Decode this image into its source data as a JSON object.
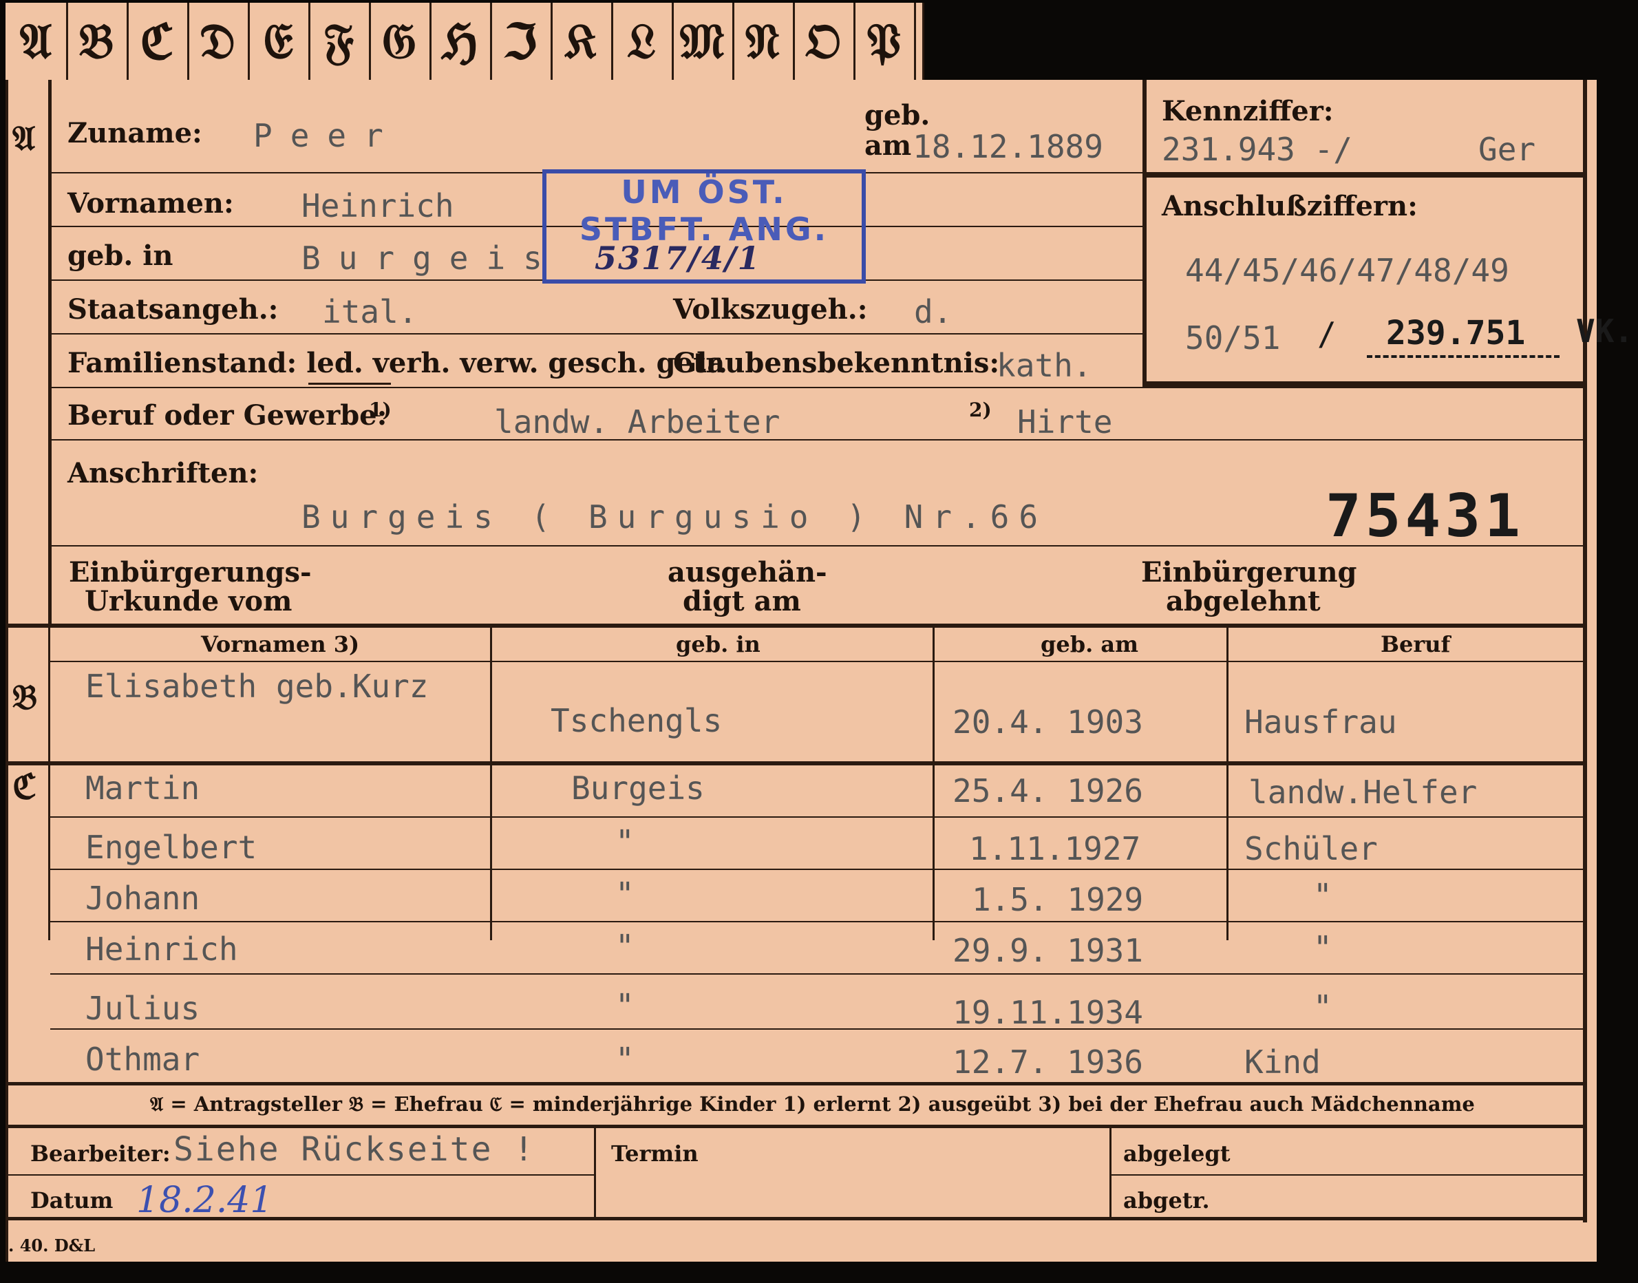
{
  "tabs": [
    "𝔄",
    "𝔅",
    "ℭ",
    "𝔇",
    "𝔈",
    "𝔉",
    "𝔊",
    "ℌ",
    "ℑ",
    "𝔎",
    "𝔏",
    "𝔐",
    "𝔑",
    "𝔒",
    "𝔓"
  ],
  "sections": {
    "a": "𝔄",
    "b": "𝔅",
    "c": "ℭ"
  },
  "applicant": {
    "surname_label": "Zuname:",
    "surname": "Peer",
    "born_label": "geb. am",
    "born_date": "18.12.1889",
    "first_names_label": "Vornamen:",
    "first_names": "Heinrich",
    "birthplace_label": "geb. in",
    "birthplace": "Burgeis",
    "citizenship_label": "Staatsangeh.:",
    "citizenship": "ital.",
    "ethnicity_label": "Volkszugeh.:",
    "ethnicity": "d.",
    "marital_label": "Familienstand: led. verh. verw. gesch. getr.",
    "religion_label": "Glaubensbekenntnis:",
    "religion": "kath.",
    "occupation_label": "Beruf oder Gewerbe:",
    "occ1_marker": "1)",
    "occupation_learned": "landw. Arbeiter",
    "occ2_marker": "2)",
    "occupation_practiced": "Hirte",
    "address_label": "Anschriften:",
    "address": "Burgeis ( Burgusio ) Nr.66",
    "number": "75431",
    "naturalization_label_1": "Einbürgerungs-",
    "naturalization_label_2": "Urkunde vom",
    "handed_label_1": "ausgehän-",
    "handed_label_2": "digt am",
    "refused_label_1": "Einbürgerung",
    "refused_label_2": "abgelehnt"
  },
  "stamp": {
    "line1": "UM ÖST.",
    "line2": "STBFT. ANG.",
    "handwritten": "5317/4/1"
  },
  "reference": {
    "kennziffer_label": "Kennziffer:",
    "kennziffer": "231.943 -/",
    "kennziffer_suffix": "Ger",
    "anschluss_label": "Anschlußziffern:",
    "anschluss_1": "44/45/46/47/48/49",
    "anschluss_2": "50/51",
    "anschluss_sep": "/",
    "anschluss_3": "239.751",
    "anschluss_suffix": "VK."
  },
  "table": {
    "headers": [
      "Vornamen 3)",
      "geb. in",
      "geb. am",
      "Beruf"
    ],
    "wife": {
      "name": "Elisabeth geb.Kurz",
      "place": "Tschengls",
      "date": "20.4. 1903",
      "job": "Hausfrau"
    },
    "children": [
      {
        "name": "Martin",
        "place": "Burgeis",
        "date": "25.4. 1926",
        "job": "landw.Helfer"
      },
      {
        "name": "Engelbert",
        "place": "\"",
        "date": "1.11.1927",
        "job": "Schüler"
      },
      {
        "name": "Johann",
        "place": "\"",
        "date": "1.5. 1929",
        "job": "\""
      },
      {
        "name": "Heinrich",
        "place": "\"",
        "date": "29.9. 1931",
        "job": "\""
      },
      {
        "name": "Julius",
        "place": "\"",
        "date": "19.11.1934",
        "job": "\""
      },
      {
        "name": "Othmar",
        "place": "\"",
        "date": "12.7. 1936",
        "job": "Kind"
      }
    ]
  },
  "legend": "𝔄 = Antragsteller   𝔅 = Ehefrau   ℭ = minderjährige Kinder   1) erlernt   2) ausgeübt   3) bei der Ehefrau auch Mädchenname",
  "footer": {
    "processor_label": "Bearbeiter:",
    "processor": "Siehe Rückseite !",
    "date_label": "Datum",
    "date": "18.2.41",
    "deadline_label": "Termin",
    "filed_label": "abgelegt",
    "removed_label": "abgetr.",
    "print_mark": ". 40. D&L"
  }
}
